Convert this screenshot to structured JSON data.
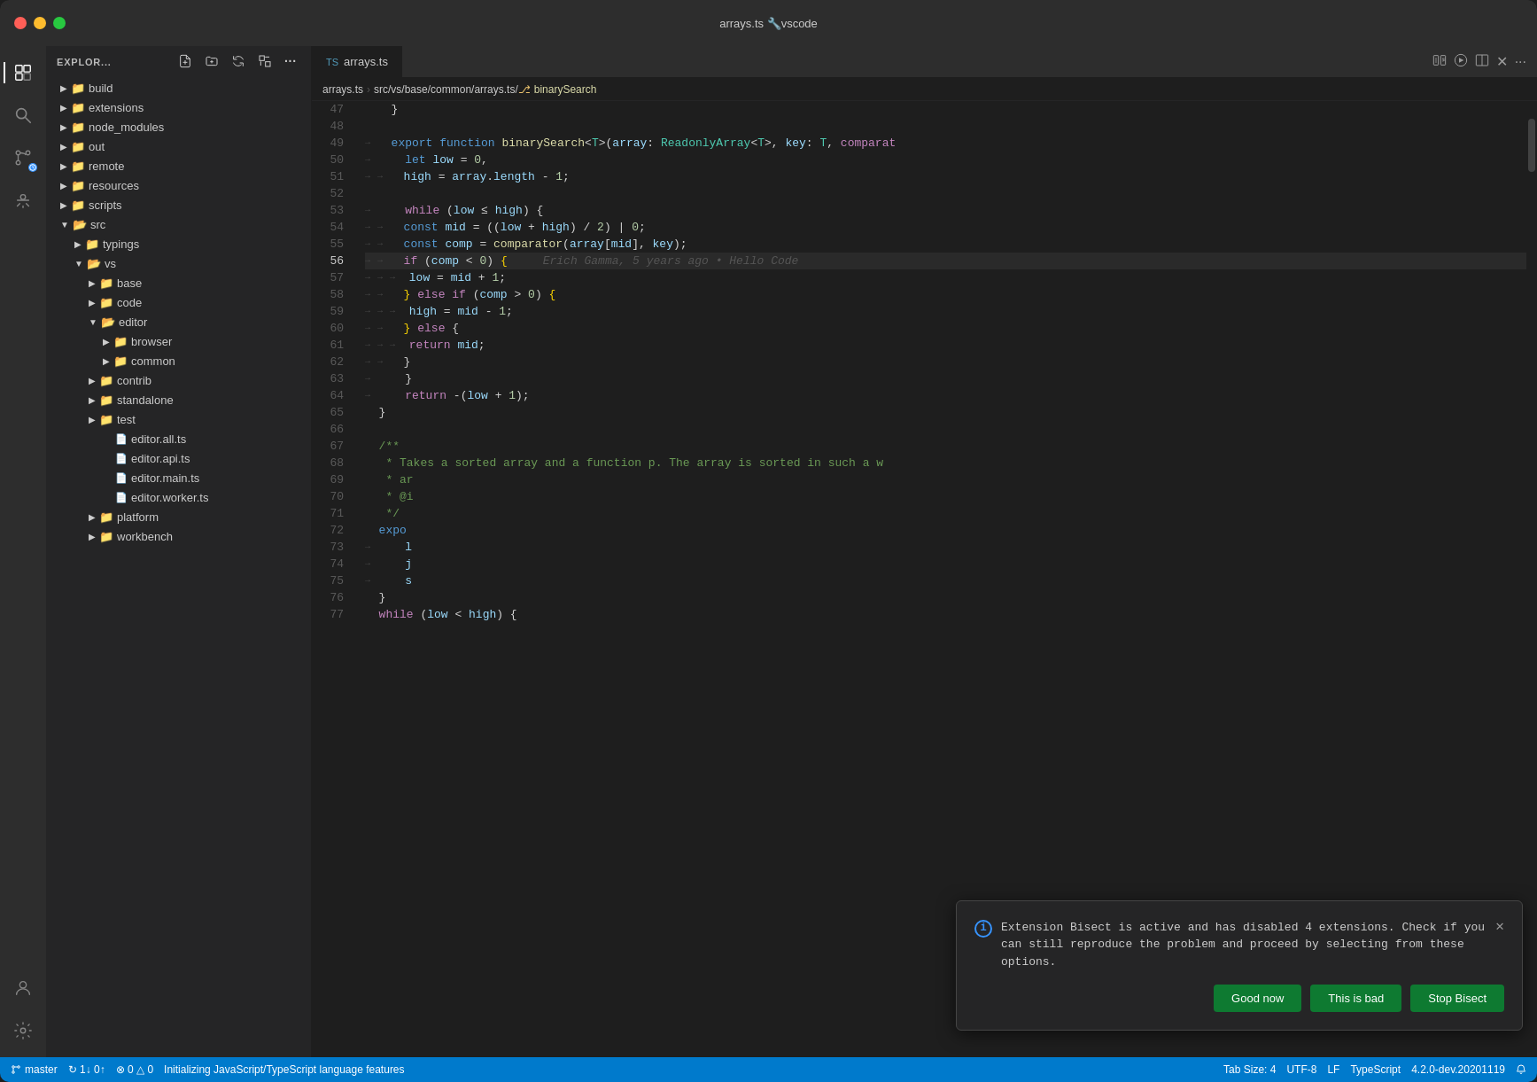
{
  "titlebar": {
    "title": "arrays.ts 🔧vscode"
  },
  "activityBar": {
    "icons": [
      {
        "id": "explorer",
        "symbol": "⧉",
        "active": true
      },
      {
        "id": "search",
        "symbol": "🔍",
        "active": false
      },
      {
        "id": "source-control",
        "symbol": "⑂",
        "active": false
      },
      {
        "id": "debug",
        "symbol": "🐛",
        "active": false
      }
    ],
    "bottomIcons": [
      {
        "id": "account",
        "symbol": "👤"
      },
      {
        "id": "settings",
        "symbol": "⚙"
      }
    ]
  },
  "sidebar": {
    "title": "EXPLOR...",
    "tree": [
      {
        "label": "build",
        "type": "folder",
        "collapsed": true,
        "indent": 1
      },
      {
        "label": "extensions",
        "type": "folder",
        "collapsed": true,
        "indent": 1
      },
      {
        "label": "node_modules",
        "type": "folder",
        "collapsed": true,
        "indent": 1
      },
      {
        "label": "out",
        "type": "folder",
        "collapsed": true,
        "indent": 1
      },
      {
        "label": "remote",
        "type": "folder",
        "collapsed": true,
        "indent": 1
      },
      {
        "label": "resources",
        "type": "folder",
        "collapsed": true,
        "indent": 1
      },
      {
        "label": "scripts",
        "type": "folder",
        "collapsed": true,
        "indent": 1
      },
      {
        "label": "src",
        "type": "folder",
        "collapsed": false,
        "indent": 1
      },
      {
        "label": "typings",
        "type": "folder",
        "collapsed": true,
        "indent": 2
      },
      {
        "label": "vs",
        "type": "folder",
        "collapsed": false,
        "indent": 2
      },
      {
        "label": "base",
        "type": "folder",
        "collapsed": true,
        "indent": 3
      },
      {
        "label": "code",
        "type": "folder",
        "collapsed": true,
        "indent": 3
      },
      {
        "label": "editor",
        "type": "folder",
        "collapsed": false,
        "indent": 3
      },
      {
        "label": "browser",
        "type": "folder",
        "collapsed": true,
        "indent": 4
      },
      {
        "label": "common",
        "type": "folder",
        "collapsed": true,
        "indent": 4
      },
      {
        "label": "contrib",
        "type": "folder",
        "collapsed": true,
        "indent": 3
      },
      {
        "label": "standalone",
        "type": "folder",
        "collapsed": true,
        "indent": 3
      },
      {
        "label": "test",
        "type": "folder",
        "collapsed": true,
        "indent": 3
      },
      {
        "label": "editor.all.ts",
        "type": "file",
        "indent": 4
      },
      {
        "label": "editor.api.ts",
        "type": "file",
        "indent": 4
      },
      {
        "label": "editor.main.ts",
        "type": "file",
        "indent": 4
      },
      {
        "label": "editor.worker.ts",
        "type": "file",
        "indent": 4
      },
      {
        "label": "platform",
        "type": "folder",
        "collapsed": true,
        "indent": 3
      },
      {
        "label": "workbench",
        "type": "folder",
        "collapsed": true,
        "indent": 3
      }
    ]
  },
  "editor": {
    "filename": "arrays.ts",
    "path": "src/vs/base/common/arrays.ts/",
    "symbol": "binarySearch",
    "lines": [
      {
        "num": "47",
        "content": "  }"
      },
      {
        "num": "48",
        "content": ""
      },
      {
        "num": "49",
        "content": "  export function binarySearch<T>(array: ReadonlyArray<T>, key: T, comparat"
      },
      {
        "num": "50",
        "content": "    let low = 0,"
      },
      {
        "num": "51",
        "content": "      high = array.length - 1;"
      },
      {
        "num": "52",
        "content": ""
      },
      {
        "num": "53",
        "content": "    while (low ≤ high) {"
      },
      {
        "num": "54",
        "content": "      const mid = ((low + high) / 2) | 0;"
      },
      {
        "num": "55",
        "content": "      const comp = comparator(array[mid], key);"
      },
      {
        "num": "56",
        "content": "      if (comp < 0) {",
        "ghost": "Erich Gamma, 5 years ago • Hello Code"
      },
      {
        "num": "57",
        "content": "        low = mid + 1;"
      },
      {
        "num": "58",
        "content": "      } else if (comp > 0) {"
      },
      {
        "num": "59",
        "content": "        high = mid - 1;"
      },
      {
        "num": "60",
        "content": "      } else {"
      },
      {
        "num": "61",
        "content": "        return mid;"
      },
      {
        "num": "62",
        "content": "      }"
      },
      {
        "num": "63",
        "content": "    }"
      },
      {
        "num": "64",
        "content": "    return -(low + 1);"
      },
      {
        "num": "65",
        "content": "  }"
      },
      {
        "num": "66",
        "content": ""
      },
      {
        "num": "67",
        "content": "  /**"
      },
      {
        "num": "68",
        "content": "   * Takes a sorted array and a function p. The array is sorted in such a w"
      },
      {
        "num": "69",
        "content": "   * ar"
      },
      {
        "num": "70",
        "content": "   * @i"
      },
      {
        "num": "71",
        "content": "   */"
      },
      {
        "num": "72",
        "content": "  expo"
      },
      {
        "num": "73",
        "content": "    l"
      },
      {
        "num": "74",
        "content": "    j"
      },
      {
        "num": "75",
        "content": "    s"
      },
      {
        "num": "76",
        "content": "  }"
      },
      {
        "num": "77",
        "content": "  while (low < high) {"
      }
    ]
  },
  "bisectPopup": {
    "message": "Extension Bisect is active and has disabled 4 extensions. Check if you can still reproduce the problem and proceed by selecting from these options.",
    "buttons": {
      "goodNow": "Good now",
      "thisIsBad": "This is bad",
      "stopBisect": "Stop Bisect"
    }
  },
  "statusBar": {
    "branch": "master",
    "sync": "↻ 1↓ 0↑",
    "errors": "⊗ 0 △ 0",
    "message": "Initializing JavaScript/TypeScript language features",
    "tabSize": "Tab Size: 4",
    "encoding": "UTF-8",
    "lineEnding": "LF",
    "language": "TypeScript",
    "version": "4.2.0-dev.20201119"
  }
}
